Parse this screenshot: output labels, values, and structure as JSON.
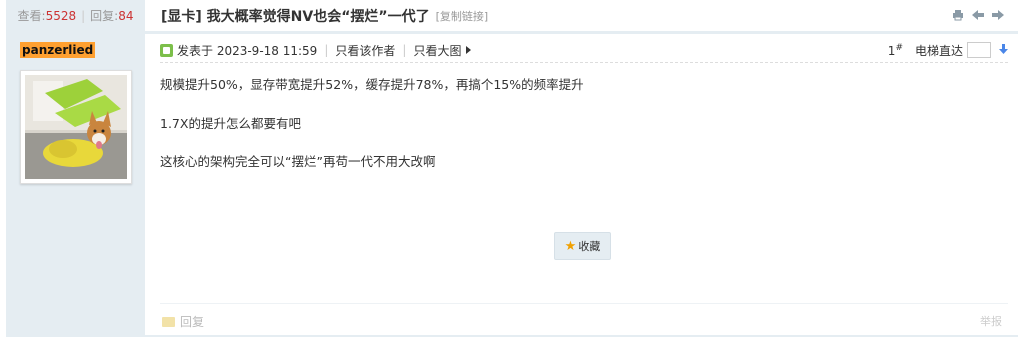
{
  "stats": {
    "views_label": "查看:",
    "views": "5528",
    "replies_label": "回复:",
    "replies": "84"
  },
  "thread": {
    "title": "[显卡] 我大概率觉得NV也会“摆烂”一代了",
    "copy_link": "[复制链接]"
  },
  "author": {
    "username": "panzerlied"
  },
  "post": {
    "posted_at": "发表于 2023-9-18 11:59",
    "only_author": "只看该作者",
    "only_big_pic": "只看大图",
    "floor": "1",
    "floor_sup": "#",
    "jump_label": "电梯直达",
    "lines": [
      "规模提升50%，显存带宽提升52%，缓存提升78%，再搞个15%的频率提升",
      "1.7X的提升怎么都要有吧",
      "这核心的架构完全可以“摆烂”再苟一代不用大改啊"
    ],
    "favorite": "收藏",
    "reply": "回复",
    "report": "举报"
  },
  "colors": {
    "sidebar_bg": "#E5EDF2",
    "username_bg": "#FFA030",
    "accent_red": "#CC3333"
  },
  "icons": [
    "print-icon",
    "prev-thread-icon",
    "next-thread-icon",
    "online-status-icon",
    "star-icon",
    "reply-icon",
    "jump-arrow-icon"
  ]
}
